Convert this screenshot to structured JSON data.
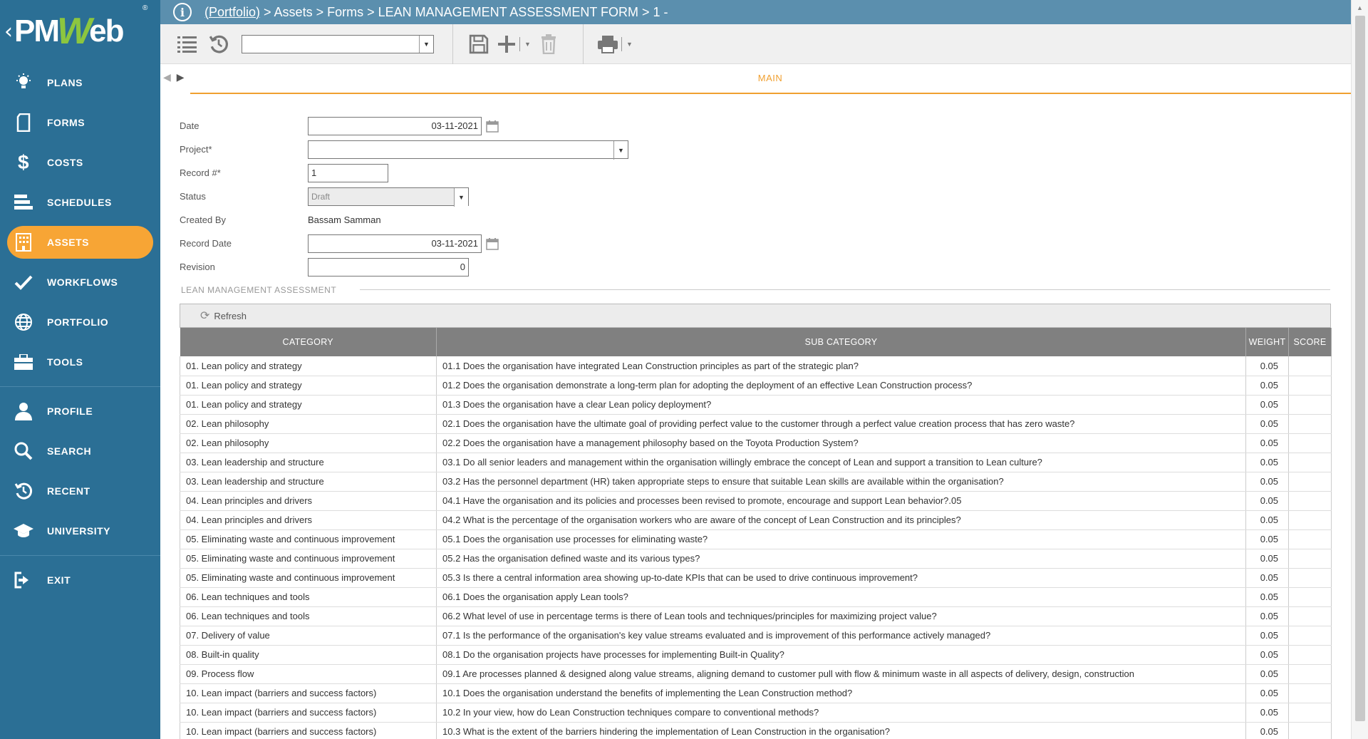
{
  "logo": {
    "back": "‹",
    "pm": "PM",
    "w": "W",
    "eb": "eb",
    "reg": "®"
  },
  "sidebar": {
    "items": [
      {
        "label": "PLANS",
        "icon": "lightbulb-icon"
      },
      {
        "label": "FORMS",
        "icon": "document-icon"
      },
      {
        "label": "COSTS",
        "icon": "dollar-icon"
      },
      {
        "label": "SCHEDULES",
        "icon": "gantt-icon"
      },
      {
        "label": "ASSETS",
        "icon": "building-icon",
        "active": true
      },
      {
        "label": "WORKFLOWS",
        "icon": "check-icon"
      },
      {
        "label": "PORTFOLIO",
        "icon": "globe-icon"
      },
      {
        "label": "TOOLS",
        "icon": "toolbox-icon"
      },
      {
        "label": "PROFILE",
        "icon": "user-icon"
      },
      {
        "label": "SEARCH",
        "icon": "search-icon"
      },
      {
        "label": "RECENT",
        "icon": "recent-icon"
      },
      {
        "label": "UNIVERSITY",
        "icon": "graduation-cap-icon"
      },
      {
        "label": "EXIT",
        "icon": "exit-icon"
      }
    ]
  },
  "breadcrumb": {
    "portfolio": "(Portfolio)",
    "rest": " > Assets > Forms > LEAN MANAGEMENT ASSESSMENT FORM > 1 -"
  },
  "toolbar": {
    "view_select_value": ""
  },
  "tabs": {
    "main": "MAIN"
  },
  "form": {
    "date_label": "Date",
    "date_value": "03-11-2021",
    "project_label": "Project*",
    "project_value": "",
    "record_label": "Record #*",
    "record_value": "1",
    "status_label": "Status",
    "status_value": "Draft",
    "created_by_label": "Created By",
    "created_by_value": "Bassam Samman",
    "record_date_label": "Record Date",
    "record_date_value": "03-11-2021",
    "revision_label": "Revision",
    "revision_value": "0"
  },
  "section": {
    "title": "LEAN MANAGEMENT ASSESSMENT"
  },
  "grid": {
    "refresh_label": "Refresh",
    "columns": [
      "CATEGORY",
      "SUB CATEGORY",
      "WEIGHT",
      "SCORE"
    ],
    "rows": [
      [
        "01. Lean policy and strategy",
        "01.1 Does the organisation have integrated Lean Construction principles as part of the strategic plan?",
        "0.05",
        ""
      ],
      [
        "01. Lean policy and strategy",
        "01.2 Does the organisation demonstrate a long-term plan for adopting the deployment of an effective Lean Construction process?",
        "0.05",
        ""
      ],
      [
        "01. Lean policy and strategy",
        "01.3 Does the organisation have a clear Lean policy deployment?",
        "0.05",
        ""
      ],
      [
        "02. Lean philosophy",
        "02.1 Does the organisation have the ultimate goal of providing perfect value to the customer through a perfect value creation process that has zero waste?",
        "0.05",
        ""
      ],
      [
        "02. Lean philosophy",
        "02.2 Does the organisation have a management philosophy based on the Toyota Production System?",
        "0.05",
        ""
      ],
      [
        "03. Lean leadership and structure",
        "03.1 Do all senior leaders and management within the organisation willingly embrace the concept of Lean and support a transition to Lean culture?",
        "0.05",
        ""
      ],
      [
        "03. Lean leadership and structure",
        "03.2 Has the personnel department (HR) taken appropriate steps to ensure that suitable Lean skills are available within the organisation?",
        "0.05",
        ""
      ],
      [
        "04. Lean principles and drivers",
        "04.1 Have the organisation and its policies and processes been revised to promote, encourage and support Lean behavior?.05",
        "0.05",
        ""
      ],
      [
        "04. Lean principles and drivers",
        "04.2 What is the percentage of the organisation workers who are aware of the concept of Lean Construction and its principles?",
        "0.05",
        ""
      ],
      [
        "05. Eliminating waste and continuous improvement",
        "05.1 Does the organisation use processes for eliminating waste?",
        "0.05",
        ""
      ],
      [
        "05. Eliminating waste and continuous improvement",
        "05.2 Has the organisation defined waste and its various types?",
        "0.05",
        ""
      ],
      [
        "05. Eliminating waste and continuous improvement",
        "05.3 Is there a central information area showing up-to-date KPIs that can be used to drive continuous improvement?",
        "0.05",
        ""
      ],
      [
        "06. Lean techniques and tools",
        "06.1 Does the organisation apply Lean tools?",
        "0.05",
        ""
      ],
      [
        "06. Lean techniques and tools",
        "06.2 What level of use in percentage terms is there of Lean tools and techniques/principles for maximizing project value?",
        "0.05",
        ""
      ],
      [
        "07. Delivery of value",
        "07.1 Is the performance of the organisation's key value streams evaluated and is improvement of this performance actively managed?",
        "0.05",
        ""
      ],
      [
        "08. Built-in quality",
        "08.1 Do the organisation projects have processes for implementing Built-in Quality?",
        "0.05",
        ""
      ],
      [
        "09. Process flow",
        "09.1 Are processes planned & designed along value streams, aligning demand to customer pull with flow & minimum waste in all aspects of delivery, design, construction",
        "0.05",
        ""
      ],
      [
        "10. Lean impact (barriers and success factors)",
        "10.1 Does the organisation understand the benefits of implementing the Lean Construction method?",
        "0.05",
        ""
      ],
      [
        "10. Lean impact (barriers and success factors)",
        "10.2 In your view, how do Lean Construction techniques compare to conventional methods?",
        "0.05",
        ""
      ],
      [
        "10. Lean impact (barriers and success factors)",
        "10.3 What is the extent of the barriers hindering the implementation of Lean Construction in the organisation?",
        "0.05",
        ""
      ]
    ]
  },
  "colors": {
    "sidebar": "#2b6f95",
    "active": "#f7a535",
    "topbar": "#5b8fae",
    "accent": "#f0a030",
    "header": "#808080"
  }
}
